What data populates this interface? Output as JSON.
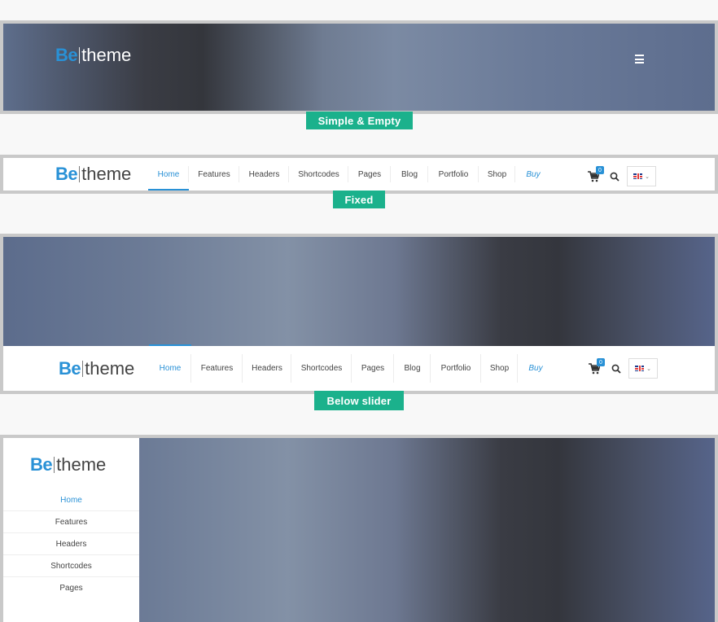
{
  "logo": {
    "be": "Be",
    "theme": "theme"
  },
  "labels": {
    "simple": "Simple & Empty",
    "fixed": "Fixed",
    "below": "Below slider"
  },
  "menu": {
    "items": [
      "Home",
      "Features",
      "Headers",
      "Shortcodes",
      "Pages",
      "Blog",
      "Portfolio",
      "Shop",
      "Buy"
    ],
    "active": "Home",
    "cart_count": "0"
  },
  "sidebar": {
    "items": [
      "Home",
      "Features",
      "Headers",
      "Shortcodes",
      "Pages"
    ]
  },
  "colors": {
    "accent": "#2991d6",
    "label_bg": "#1bb18c",
    "frame_border": "#c9c9c9"
  },
  "icons": [
    "menu-icon",
    "cart-icon",
    "search-icon",
    "uk-flag-icon",
    "chevron-down-icon"
  ]
}
